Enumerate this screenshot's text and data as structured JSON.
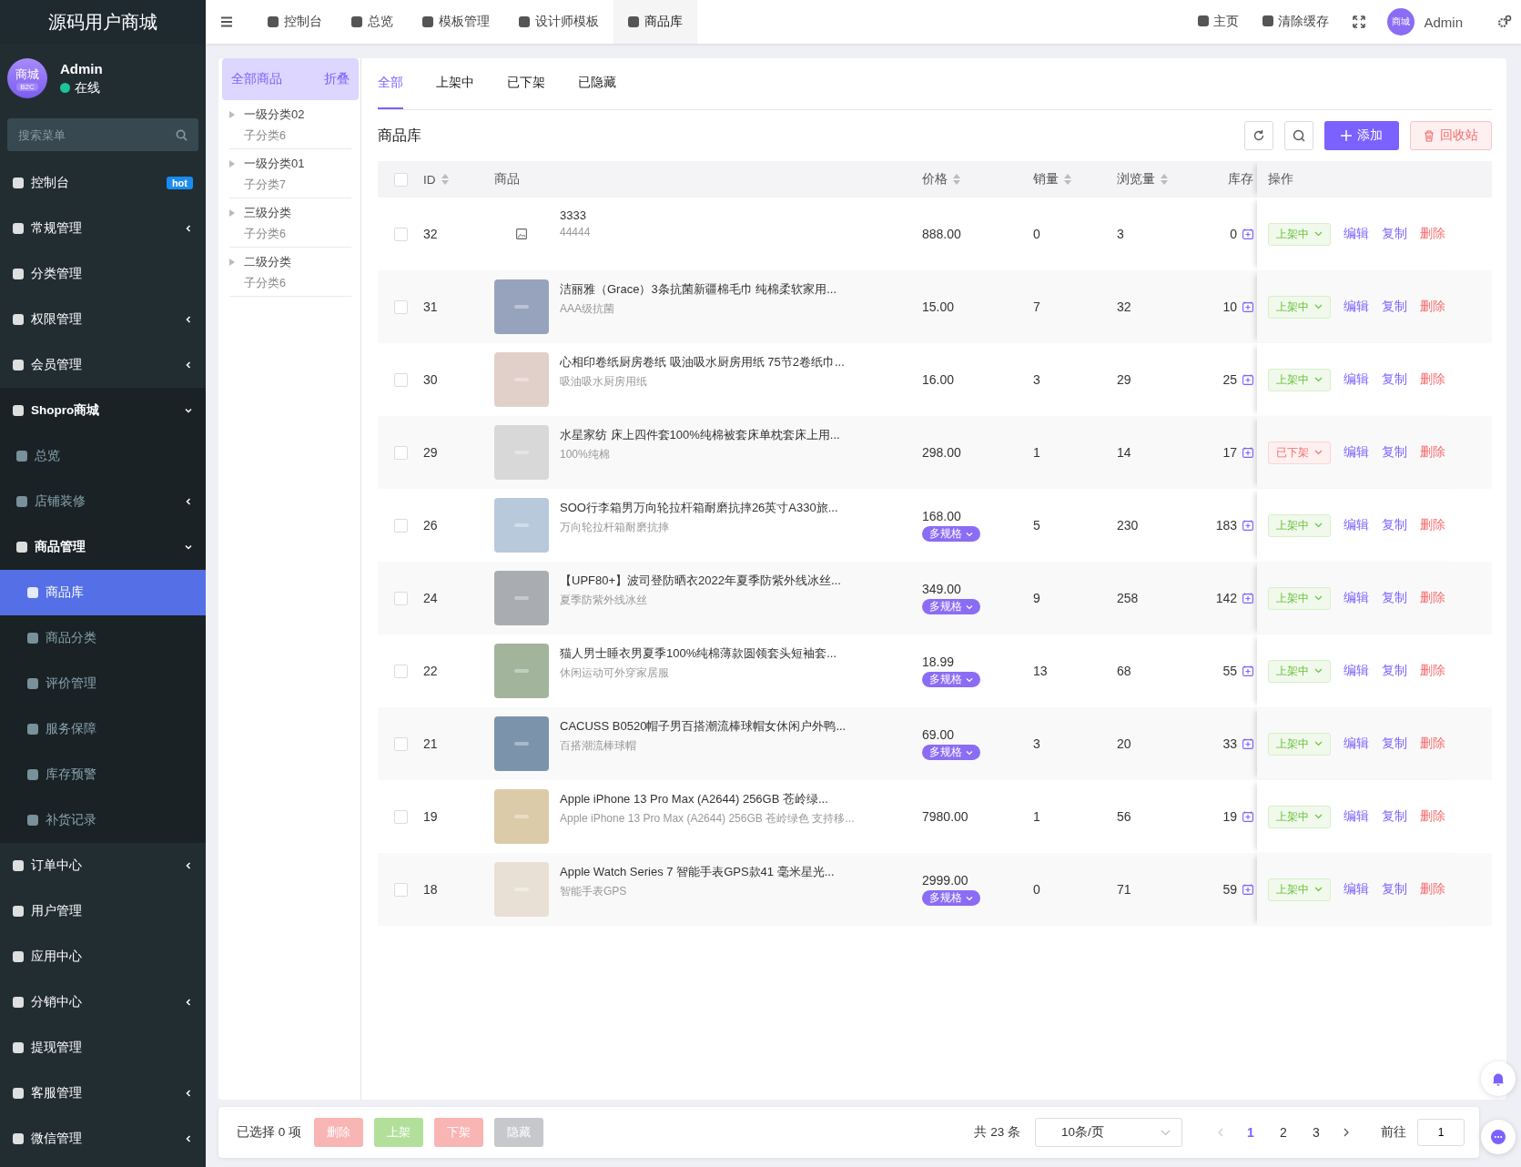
{
  "sidebar": {
    "brand": "源码用户商城",
    "avatar": {
      "text": "商城",
      "badge": "B2C"
    },
    "user": {
      "name": "Admin",
      "status": "在线"
    },
    "search": {
      "placeholder": "搜索菜单"
    },
    "items": [
      {
        "label": "控制台",
        "badge": "hot",
        "selected": false
      },
      {
        "label": "常规管理",
        "expanded": false,
        "selected": false
      },
      {
        "label": "分类管理",
        "selected": false
      },
      {
        "label": "权限管理",
        "expanded": false,
        "selected": false
      },
      {
        "label": "会员管理",
        "expanded": false,
        "selected": false
      },
      {
        "label": "Shopro商城",
        "expanded": true,
        "selected": false,
        "children": [
          {
            "label": "总览",
            "selected": false
          },
          {
            "label": "店铺装修",
            "expanded": false,
            "selected": false
          },
          {
            "label": "商品管理",
            "expanded": true,
            "selected": false,
            "children": [
              {
                "label": "商品库",
                "selected": true
              },
              {
                "label": "商品分类",
                "selected": false
              },
              {
                "label": "评价管理",
                "selected": false
              },
              {
                "label": "服务保障",
                "selected": false
              },
              {
                "label": "库存预警",
                "selected": false
              },
              {
                "label": "补货记录",
                "selected": false
              }
            ]
          }
        ]
      },
      {
        "label": "订单中心",
        "expanded": false,
        "selected": false
      },
      {
        "label": "用户管理",
        "selected": false
      },
      {
        "label": "应用中心",
        "selected": false
      },
      {
        "label": "分销中心",
        "expanded": false,
        "selected": false
      },
      {
        "label": "提现管理",
        "selected": false
      },
      {
        "label": "客服管理",
        "expanded": false,
        "selected": false
      },
      {
        "label": "微信管理",
        "expanded": false,
        "selected": false
      }
    ]
  },
  "topbar": {
    "tabs": [
      {
        "label": "控制台",
        "selected": false
      },
      {
        "label": "总览",
        "selected": false
      },
      {
        "label": "模板管理",
        "selected": false
      },
      {
        "label": "设计师模板",
        "selected": false
      },
      {
        "label": "商品库",
        "selected": true
      }
    ],
    "links": [
      "主页",
      "清除缓存"
    ],
    "avatar": "商城",
    "user": "Admin"
  },
  "categories": {
    "header": "全部商品",
    "collapse": "折叠",
    "items": [
      {
        "name": "一级分类02",
        "sub": "子分类6"
      },
      {
        "name": "一级分类01",
        "sub": "子分类7"
      },
      {
        "name": "三级分类",
        "sub": "子分类6"
      },
      {
        "name": "二级分类",
        "sub": "子分类6"
      }
    ]
  },
  "tabs": [
    {
      "label": "全部",
      "selected": true
    },
    {
      "label": "上架中",
      "selected": false
    },
    {
      "label": "已下架",
      "selected": false
    },
    {
      "label": "已隐藏",
      "selected": false
    }
  ],
  "title": "商品库",
  "toolbar": {
    "add": "添加",
    "recycle": "回收站"
  },
  "table": {
    "select_all_checked": false,
    "columns": [
      {
        "label": "ID",
        "sortable": true
      },
      {
        "label": "商品",
        "sortable": false
      },
      {
        "label": "价格",
        "sortable": true
      },
      {
        "label": "销量",
        "sortable": true
      },
      {
        "label": "浏览量",
        "sortable": true
      },
      {
        "label": "库存",
        "sortable": false
      },
      {
        "label": "操作",
        "sortable": false
      }
    ],
    "rows": [
      {
        "id": "32",
        "checked": false,
        "has_image": false,
        "name": "3333",
        "sub": "44444",
        "price": "888.00",
        "sales": "0",
        "views": "3",
        "stock": "0",
        "status": "上架中",
        "listed": true,
        "actions": [
          "编辑",
          "复制",
          "删除"
        ]
      },
      {
        "id": "31",
        "checked": false,
        "has_image": true,
        "name": "洁丽雅（Grace）3条抗菌新疆棉毛巾 纯棉柔软家用...",
        "sub": "AAA级抗菌",
        "price": "15.00",
        "sales": "7",
        "views": "32",
        "stock": "10",
        "status": "上架中",
        "listed": true,
        "actions": [
          "编辑",
          "复制",
          "删除"
        ]
      },
      {
        "id": "30",
        "checked": false,
        "has_image": true,
        "name": "心相印卷纸厨房卷纸 吸油吸水厨房用纸 75节2卷纸巾...",
        "sub": "吸油吸水厨房用纸",
        "price": "16.00",
        "sales": "3",
        "views": "29",
        "stock": "25",
        "status": "上架中",
        "listed": true,
        "actions": [
          "编辑",
          "复制",
          "删除"
        ]
      },
      {
        "id": "29",
        "checked": false,
        "has_image": true,
        "name": "水星家纺 床上四件套100%纯棉被套床单枕套床上用...",
        "sub": "100%纯棉",
        "price": "298.00",
        "sales": "1",
        "views": "14",
        "stock": "17",
        "status": "已下架",
        "listed": false,
        "actions": [
          "编辑",
          "复制",
          "删除"
        ]
      },
      {
        "id": "26",
        "checked": false,
        "has_image": true,
        "name": "SOO行李箱男万向轮拉杆箱耐磨抗摔26英寸A330旅...",
        "sub": "万向轮拉杆箱耐磨抗摔",
        "price": "168.00",
        "spec": "多规格",
        "sales": "5",
        "views": "230",
        "stock": "183",
        "status": "上架中",
        "listed": true,
        "actions": [
          "编辑",
          "复制",
          "删除"
        ]
      },
      {
        "id": "24",
        "checked": false,
        "has_image": true,
        "name": "【UPF80+】波司登防晒衣2022年夏季防紫外线冰丝...",
        "sub": "夏季防紫外线冰丝",
        "price": "349.00",
        "spec": "多规格",
        "sales": "9",
        "views": "258",
        "stock": "142",
        "status": "上架中",
        "listed": true,
        "actions": [
          "编辑",
          "复制",
          "删除"
        ]
      },
      {
        "id": "22",
        "checked": false,
        "has_image": true,
        "name": "猫人男士睡衣男夏季100%纯棉薄款圆领套头短袖套...",
        "sub": "休闲运动可外穿家居服",
        "price": "18.99",
        "spec": "多规格",
        "sales": "13",
        "views": "68",
        "stock": "55",
        "status": "上架中",
        "listed": true,
        "actions": [
          "编辑",
          "复制",
          "删除"
        ]
      },
      {
        "id": "21",
        "checked": false,
        "has_image": true,
        "name": "CACUSS B0520帽子男百搭潮流棒球帽女休闲户外鸭...",
        "sub": "百搭潮流棒球帽",
        "price": "69.00",
        "spec": "多规格",
        "sales": "3",
        "views": "20",
        "stock": "33",
        "status": "上架中",
        "listed": true,
        "actions": [
          "编辑",
          "复制",
          "删除"
        ]
      },
      {
        "id": "19",
        "checked": false,
        "has_image": true,
        "name": "Apple iPhone 13 Pro Max (A2644) 256GB 苍岭绿...",
        "sub": "Apple iPhone 13 Pro Max (A2644) 256GB 苍岭绿色 支持移...",
        "price": "7980.00",
        "sales": "1",
        "views": "56",
        "stock": "19",
        "status": "上架中",
        "listed": true,
        "actions": [
          "编辑",
          "复制",
          "删除"
        ]
      },
      {
        "id": "18",
        "checked": false,
        "has_image": true,
        "name": "Apple Watch Series 7 智能手表GPS款41 毫米星光...",
        "sub": "智能手表GPS",
        "price": "2999.00",
        "spec": "多规格",
        "sales": "0",
        "views": "71",
        "stock": "59",
        "status": "上架中",
        "listed": true,
        "actions": [
          "编辑",
          "复制",
          "删除"
        ]
      }
    ]
  },
  "footer": {
    "selected": "已选择 0 项",
    "buttons": [
      {
        "label": "删除",
        "kind": "danger",
        "disabled": true
      },
      {
        "label": "上架",
        "kind": "success",
        "disabled": true
      },
      {
        "label": "下架",
        "kind": "danger",
        "disabled": true
      },
      {
        "label": "隐藏",
        "kind": "info",
        "disabled": true
      }
    ],
    "total": "共 23 条",
    "page_size": "10条/页",
    "pages": [
      {
        "label": "1",
        "selected": true
      },
      {
        "label": "2",
        "selected": false
      },
      {
        "label": "3",
        "selected": false
      }
    ],
    "goto": "前往",
    "goto_value": "1"
  }
}
